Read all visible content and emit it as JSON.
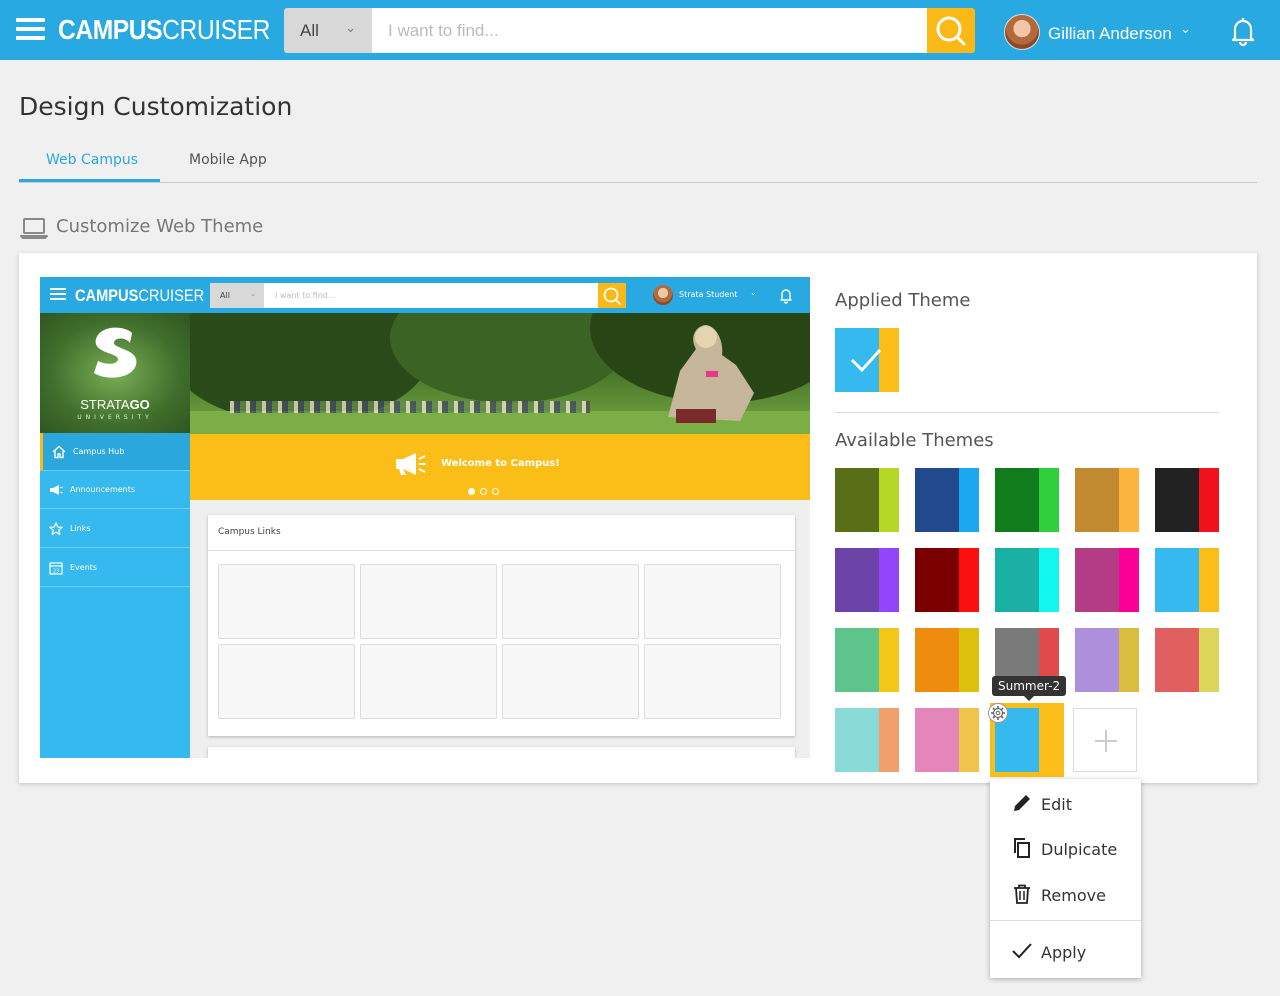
{
  "header": {
    "logo_bold": "CAMPUS",
    "logo_light": "CRUISER",
    "search_scope": "All",
    "search_placeholder": "I want to find...",
    "user_name": "Gillian Anderson"
  },
  "page": {
    "title": "Design Customization",
    "tabs": [
      {
        "label": "Web Campus",
        "active": true
      },
      {
        "label": "Mobile App",
        "active": false
      }
    ],
    "section_title": "Customize Web Theme"
  },
  "preview": {
    "logo_bold": "CAMPUS",
    "logo_light": "CRUISER",
    "search_scope": "All",
    "search_placeholder": "I want to find...",
    "user_name": "Strata Student",
    "brand_light": "STRATA",
    "brand_bold": "GO",
    "brand_sub": "UNIVERSITY",
    "nav": [
      {
        "label": "Campus Hub",
        "icon": "home-icon",
        "active": true
      },
      {
        "label": "Announcements",
        "icon": "megaphone-icon",
        "active": false
      },
      {
        "label": "Links",
        "icon": "star-icon",
        "active": false
      },
      {
        "label": "Events",
        "icon": "calendar-icon",
        "active": false,
        "icon_text": "23"
      }
    ],
    "banner_text": "Welcome to Campus!",
    "slides_total": 3,
    "slide_active": 1,
    "links_title": "Campus Links"
  },
  "themes": {
    "applied_label": "Applied Theme",
    "applied": {
      "primary": "#36b9ee",
      "secondary": "#fbbe19"
    },
    "available_label": "Available Themes",
    "available": [
      {
        "primary": "#5a6e17",
        "secondary": "#b4d825"
      },
      {
        "primary": "#214a8c",
        "secondary": "#1aa8f0"
      },
      {
        "primary": "#117c1b",
        "secondary": "#2fd03c"
      },
      {
        "primary": "#c18a30",
        "secondary": "#fbb43d"
      },
      {
        "primary": "#222222",
        "secondary": "#f0111a"
      },
      {
        "primary": "#6c44a7",
        "secondary": "#9345fb"
      },
      {
        "primary": "#7a0000",
        "secondary": "#fb0f0f"
      },
      {
        "primary": "#1ab0a3",
        "secondary": "#11f6ee"
      },
      {
        "primary": "#b33c84",
        "secondary": "#fb0096"
      },
      {
        "primary": "#36b9ee",
        "secondary": "#fbbe19"
      },
      {
        "primary": "#5dc48c",
        "secondary": "#f4c617"
      },
      {
        "primary": "#ee8c0e",
        "secondary": "#dcc10c"
      },
      {
        "primary": "#7a7a7a",
        "secondary": "#e04a4a"
      },
      {
        "primary": "#ad8fdb",
        "secondary": "#d8be3c"
      },
      {
        "primary": "#e06060",
        "secondary": "#dbd55a"
      },
      {
        "primary": "#8adad7",
        "secondary": "#f1a06c"
      },
      {
        "primary": "#e586ba",
        "secondary": "#eec54a"
      },
      {
        "primary": "#36b9ee",
        "secondary": "#fbbe19",
        "name": "Summer-2",
        "selected": true
      }
    ]
  },
  "context_menu": {
    "items": [
      {
        "label": "Edit",
        "icon": "pencil-icon"
      },
      {
        "label": "Dulpicate",
        "icon": "duplicate-icon"
      },
      {
        "label": "Remove",
        "icon": "trash-icon"
      },
      {
        "label": "Apply",
        "icon": "checkmark-icon"
      }
    ]
  }
}
